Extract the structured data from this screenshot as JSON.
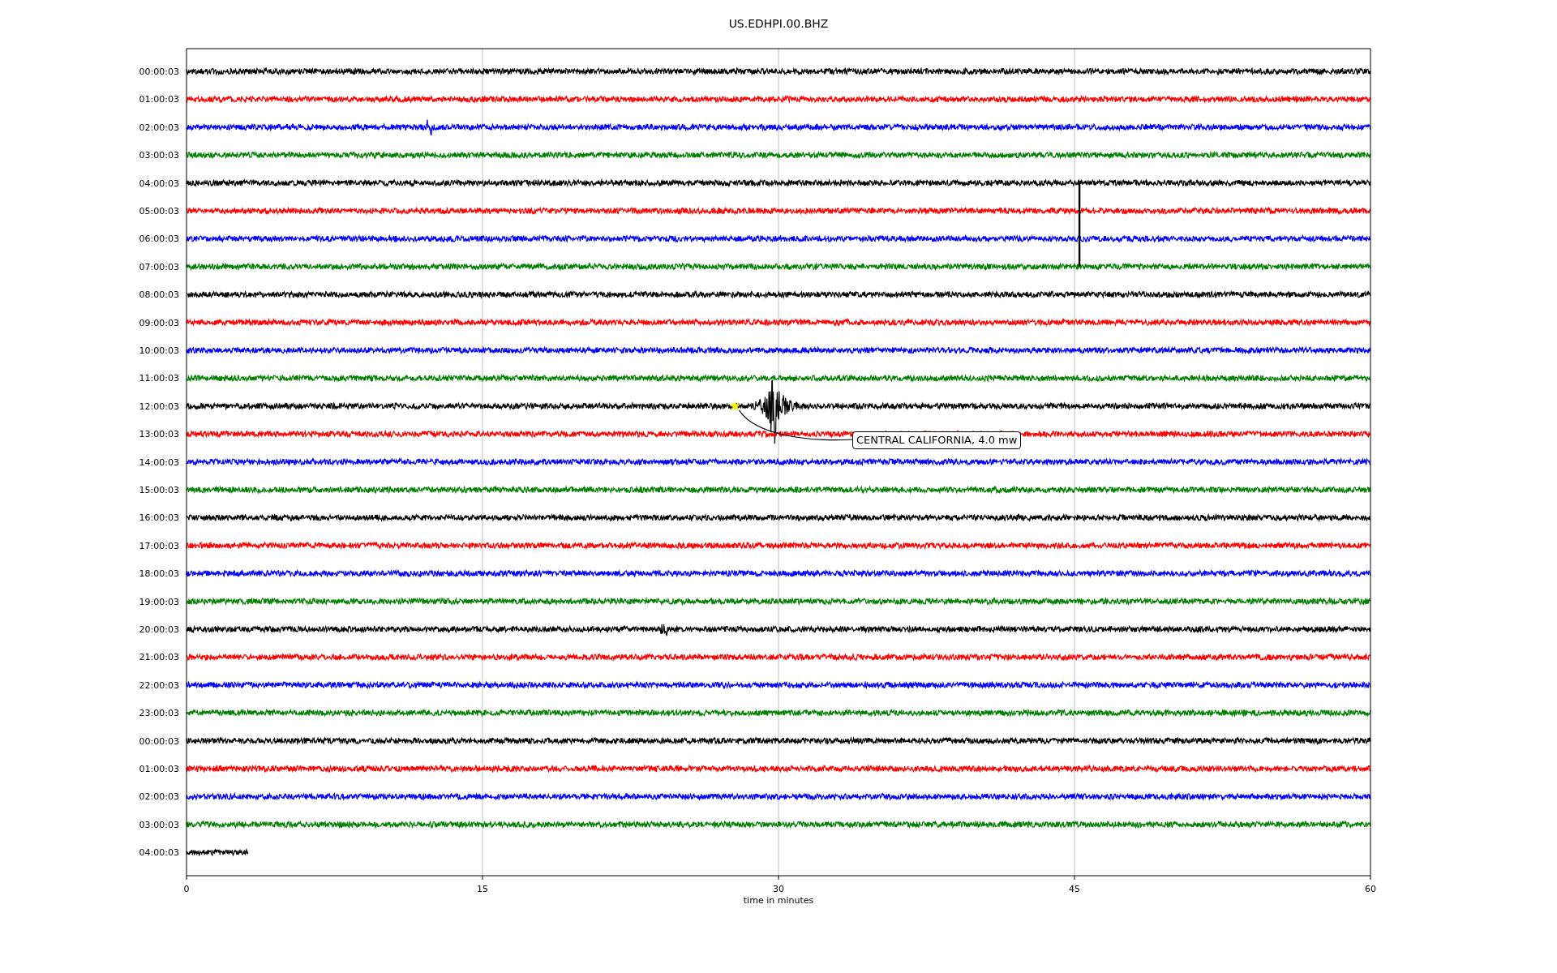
{
  "title": "US.EDHPI.00.BHZ",
  "xlabel": "time in minutes",
  "xticks": [
    "0",
    "15",
    "30",
    "45",
    "60"
  ],
  "rows": [
    {
      "label": "00:00:03",
      "color": "#000000",
      "level": 1
    },
    {
      "label": "01:00:03",
      "color": "#ff0000",
      "level": 1
    },
    {
      "label": "02:00:03",
      "color": "#0000ff",
      "level": 1
    },
    {
      "label": "03:00:03",
      "color": "#008000",
      "level": 1
    },
    {
      "label": "04:00:03",
      "color": "#000000",
      "level": 1
    },
    {
      "label": "05:00:03",
      "color": "#ff0000",
      "level": 1
    },
    {
      "label": "06:00:03",
      "color": "#0000ff",
      "level": 1
    },
    {
      "label": "07:00:03",
      "color": "#008000",
      "level": 1
    },
    {
      "label": "08:00:03",
      "color": "#000000",
      "level": 1
    },
    {
      "label": "09:00:03",
      "color": "#ff0000",
      "level": 1
    },
    {
      "label": "10:00:03",
      "color": "#0000ff",
      "level": 1
    },
    {
      "label": "11:00:03",
      "color": "#008000",
      "level": 1
    },
    {
      "label": "12:00:03",
      "color": "#000000",
      "level": 1
    },
    {
      "label": "13:00:03",
      "color": "#ff0000",
      "level": 1
    },
    {
      "label": "14:00:03",
      "color": "#0000ff",
      "level": 1
    },
    {
      "label": "15:00:03",
      "color": "#008000",
      "level": 1
    },
    {
      "label": "16:00:03",
      "color": "#000000",
      "level": 1
    },
    {
      "label": "17:00:03",
      "color": "#ff0000",
      "level": 1
    },
    {
      "label": "18:00:03",
      "color": "#0000ff",
      "level": 1
    },
    {
      "label": "19:00:03",
      "color": "#008000",
      "level": 1
    },
    {
      "label": "20:00:03",
      "color": "#000000",
      "level": 1
    },
    {
      "label": "21:00:03",
      "color": "#ff0000",
      "level": 1
    },
    {
      "label": "22:00:03",
      "color": "#0000ff",
      "level": 1
    },
    {
      "label": "23:00:03",
      "color": "#008000",
      "level": 1
    },
    {
      "label": "00:00:03",
      "color": "#000000",
      "level": 1
    },
    {
      "label": "01:00:03",
      "color": "#ff0000",
      "level": 1
    },
    {
      "label": "02:00:03",
      "color": "#0000ff",
      "level": 1
    },
    {
      "label": "03:00:03",
      "color": "#008000",
      "level": 1
    },
    {
      "label": "04:00:03",
      "color": "#000000",
      "level": 0.052
    }
  ],
  "annotation": "CENTRAL CALIFORNIA, 4.0 mw"
}
